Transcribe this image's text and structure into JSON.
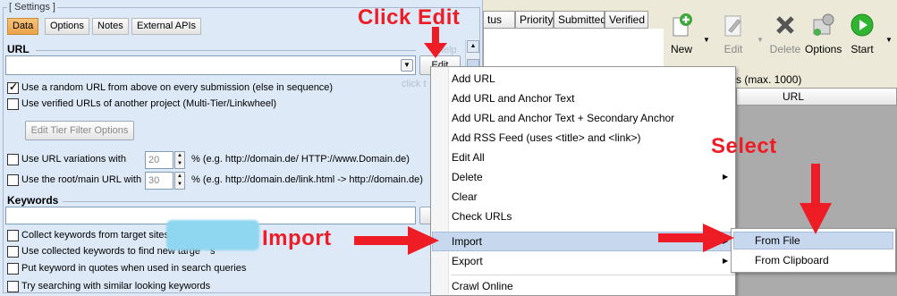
{
  "settings": {
    "group_title": "[ Settings ]",
    "tabs": [
      {
        "label": "Data",
        "active": true
      },
      {
        "label": "Options"
      },
      {
        "label": "Notes"
      },
      {
        "label": "External APIs"
      }
    ],
    "url_label": "URL",
    "url_value": "",
    "edit_button": "Edit",
    "help_text": "Help",
    "click_hint": "click t",
    "checks": [
      {
        "label": "Use a random URL from above on every submission (else in sequence)",
        "checked": true
      },
      {
        "label": "Use verified URLs of another project (Multi-Tier/Linkwheel)",
        "checked": false
      }
    ],
    "tier_filter_button": "Edit Tier Filter Options",
    "variations": {
      "label": "Use URL variations with",
      "value": "20",
      "hint": "% (e.g. http://domain.de/ HTTP://www.Domain.de)"
    },
    "root": {
      "label": "Use the root/main URL with",
      "value": "30",
      "hint": "% (e.g. http://domain.de/link.html -> http://domain.de)"
    },
    "keywords_label": "Keywords",
    "keyword_checks": [
      {
        "label": "Collect keywords from target sites",
        "checked": false
      },
      {
        "label": "Use collected keywords to find new targe",
        "tail": "s",
        "checked": false
      },
      {
        "label": "Put keyword in quotes when used in search queries",
        "checked": false
      },
      {
        "label": "Try searching with similar looking keywords",
        "checked": false
      }
    ]
  },
  "grid": {
    "columns": [
      "tus",
      "Priority",
      "Submitted",
      "Verified"
    ],
    "side_text": "s (max. 1000)",
    "url_col": "URL"
  },
  "toolbar": {
    "items": [
      {
        "label": "New",
        "icon": "new-icon",
        "disabled": false
      },
      {
        "label": "Edit",
        "icon": "edit-icon",
        "disabled": true
      },
      {
        "label": "Delete",
        "icon": "delete-icon",
        "disabled": true
      },
      {
        "label": "Options",
        "icon": "options-icon",
        "disabled": false
      },
      {
        "label": "Start",
        "icon": "start-icon",
        "disabled": false
      }
    ]
  },
  "menu": {
    "items": [
      {
        "label": "Add URL"
      },
      {
        "label": "Add URL and Anchor Text"
      },
      {
        "label": "Add URL and Anchor Text + Secondary Anchor"
      },
      {
        "label": "Add RSS Feed (uses <title> and <link>)"
      },
      {
        "label": "Edit All"
      },
      {
        "label": "Delete",
        "submenu": true
      },
      {
        "label": "Clear"
      },
      {
        "label": "Check URLs"
      },
      {
        "label": "Import",
        "submenu": true,
        "highlighted": true
      },
      {
        "label": "Export",
        "submenu": true
      },
      {
        "label": "Crawl Online"
      }
    ],
    "submenu": [
      {
        "label": "From File",
        "highlighted": true
      },
      {
        "label": "From Clipboard"
      }
    ]
  },
  "annotations": {
    "click_edit": "Click Edit",
    "select": "Select",
    "import": "Import"
  },
  "colors": {
    "annotation_red": "#ee1c25",
    "highlight": "#c7d7ee",
    "panel_bg": "#dde9f7"
  }
}
